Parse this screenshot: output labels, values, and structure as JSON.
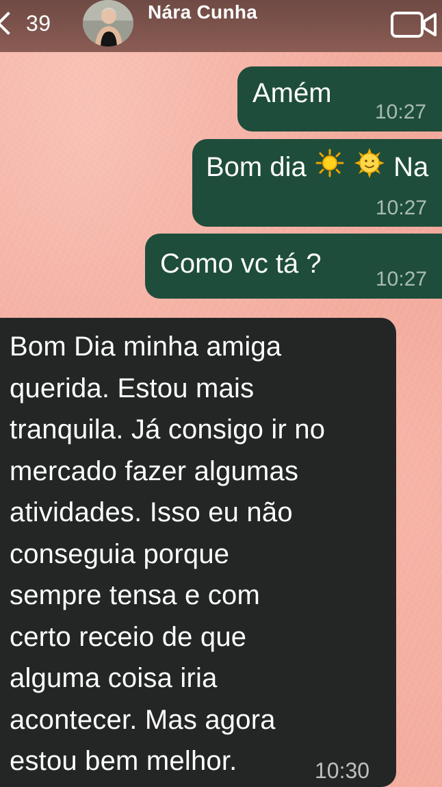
{
  "header": {
    "back_count": "39",
    "contact_name": "Nára Cunha"
  },
  "messages": [
    {
      "direction": "outgoing",
      "text": "Amém",
      "time": "10:27"
    },
    {
      "direction": "outgoing",
      "text_prefix": "Bom dia",
      "emojis": [
        "sun-emoji",
        "sun-with-face-emoji"
      ],
      "text_suffix": "Na",
      "time": "10:27"
    },
    {
      "direction": "outgoing",
      "text": "Como vc tá ?",
      "time": "10:27"
    },
    {
      "direction": "incoming",
      "lines": [
        "Bom Dia minha amiga",
        "querida. Estou mais",
        "tranquila. Já consigo ir no",
        "mercado fazer algumas",
        "atividades. Isso eu não",
        "conseguia porque",
        "sempre tensa e com",
        "certo receio de que",
        "alguma coisa iria",
        "acontecer. Mas agora",
        "estou bem melhor."
      ],
      "time": "10:30"
    }
  ],
  "colors": {
    "outgoing_bubble": "#1f4d3b",
    "incoming_bubble": "#242626",
    "header_bg": "#7a514a",
    "wallpaper": "#f1a89a"
  }
}
